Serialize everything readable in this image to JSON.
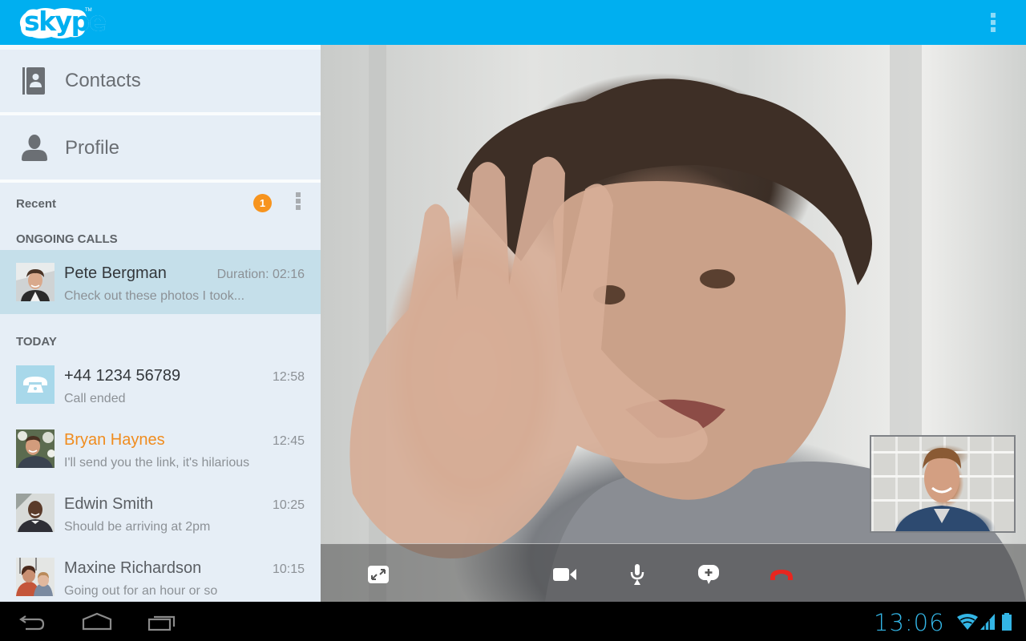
{
  "app": {
    "logo_text": "skype",
    "logo_tm": "TM",
    "brand_color": "#00aff0",
    "accent_orange": "#f7941e"
  },
  "topbar": {
    "overflow_icon": "overflow-menu-icon"
  },
  "sidebar": {
    "nav": [
      {
        "label": "Contacts",
        "icon": "contacts-book-icon"
      },
      {
        "label": "Profile",
        "icon": "person-icon"
      }
    ],
    "recent": {
      "title": "Recent",
      "badge_count": "1",
      "overflow_icon": "overflow-menu-icon"
    },
    "sections": {
      "ongoing": "ONGOING CALLS",
      "today": "TODAY"
    },
    "ongoing_calls": [
      {
        "name": "Pete Bergman",
        "status": "Duration: 02:16",
        "message": "Check out these photos I took...",
        "avatar": "pete-bergman-avatar"
      }
    ],
    "today": [
      {
        "name": "+44 1234 56789",
        "time": "12:58",
        "message": "Call ended",
        "avatar": "phone-icon"
      },
      {
        "name": "Bryan Haynes",
        "time": "12:45",
        "message": "I'll send you the link, it's hilarious",
        "avatar": "bryan-haynes-avatar",
        "highlight": true
      },
      {
        "name": "Edwin Smith",
        "time": "10:25",
        "message": "Should be arriving at 2pm",
        "avatar": "edwin-smith-avatar"
      },
      {
        "name": "Maxine Richardson",
        "time": "10:15",
        "message": "Going out for an hour or so",
        "avatar": "maxine-richardson-avatar"
      }
    ]
  },
  "video": {
    "remote_description": "Remote participant video feed (Pete Bergman waving)",
    "self_description": "Self view video preview",
    "controls": [
      {
        "name": "fullscreen",
        "icon": "fullscreen-icon"
      },
      {
        "name": "video-toggle",
        "icon": "video-camera-icon"
      },
      {
        "name": "mute",
        "icon": "microphone-icon"
      },
      {
        "name": "add-message",
        "icon": "chat-add-icon"
      },
      {
        "name": "end-call",
        "icon": "hang-up-icon",
        "color": "#e8261f"
      }
    ]
  },
  "system": {
    "clock": "13:06",
    "clock_color": "#33b5e5",
    "nav_buttons": [
      "back",
      "home",
      "recent-apps"
    ],
    "status_icons": [
      "wifi-icon",
      "signal-icon",
      "battery-icon"
    ]
  }
}
